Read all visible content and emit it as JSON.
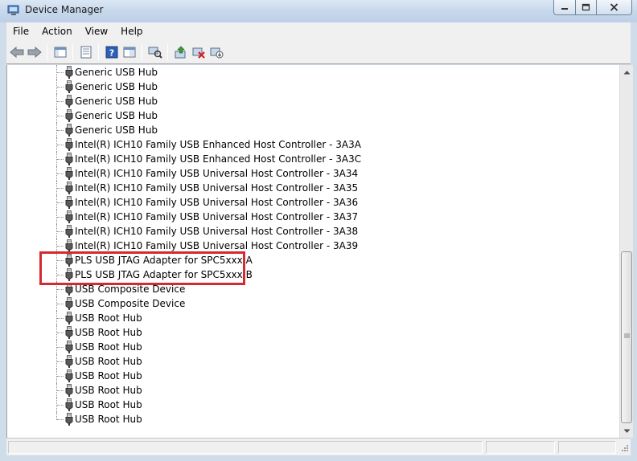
{
  "window": {
    "title": "Device Manager"
  },
  "menu": [
    "File",
    "Action",
    "View",
    "Help"
  ],
  "toolbar_icons": [
    "back-arrow-icon",
    "forward-arrow-icon",
    "show-hide-console-tree-icon",
    "properties-icon",
    "help-icon",
    "scan-hardware-icon",
    "update-driver-icon",
    "uninstall-icon",
    "disable-device-icon"
  ],
  "tree": {
    "items": [
      "Generic USB Hub",
      "Generic USB Hub",
      "Generic USB Hub",
      "Generic USB Hub",
      "Generic USB Hub",
      "Intel(R) ICH10 Family USB Enhanced Host Controller - 3A3A",
      "Intel(R) ICH10 Family USB Enhanced Host Controller - 3A3C",
      "Intel(R) ICH10 Family USB Universal Host Controller - 3A34",
      "Intel(R) ICH10 Family USB Universal Host Controller - 3A35",
      "Intel(R) ICH10 Family USB Universal Host Controller - 3A36",
      "Intel(R) ICH10 Family USB Universal Host Controller - 3A37",
      "Intel(R) ICH10 Family USB Universal Host Controller - 3A38",
      "Intel(R) ICH10 Family USB Universal Host Controller - 3A39",
      "PLS USB JTAG Adapter for SPC5xxx A",
      "PLS USB JTAG Adapter for SPC5xxx B",
      "USB Composite Device",
      "USB Composite Device",
      "USB Root Hub",
      "USB Root Hub",
      "USB Root Hub",
      "USB Root Hub",
      "USB Root Hub",
      "USB Root Hub",
      "USB Root Hub",
      "USB Root Hub"
    ],
    "item_icon": "usb-plug-icon",
    "highlight_color": "#d42a2f"
  },
  "colors": {
    "title_bar": "#c9d9ec",
    "chrome": "#f0f0f0"
  }
}
